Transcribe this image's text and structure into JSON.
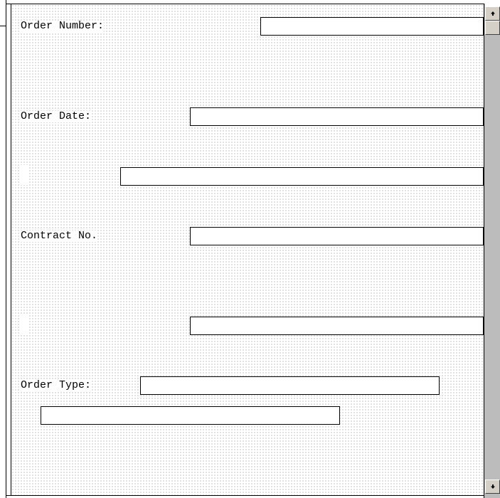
{
  "form": {
    "order_number": {
      "label": "Order Number:",
      "value": ""
    },
    "order_date": {
      "label": "Order Date:",
      "value": ""
    },
    "order_date_extra": {
      "value": ""
    },
    "contract_no": {
      "label": "Contract No.",
      "value": ""
    },
    "contract_extra": {
      "value": ""
    },
    "order_type": {
      "label": "Order Type:",
      "value": ""
    },
    "order_type_extra": {
      "value": ""
    }
  },
  "scrollbar": {
    "up_icon": "arrow-up-icon",
    "down_icon": "arrow-down-icon"
  },
  "colors": {
    "canvas_dots": "#b8b8b8",
    "scrollbar_track": "#bcbcbc",
    "scrollbar_button": "#d4d0c8"
  }
}
